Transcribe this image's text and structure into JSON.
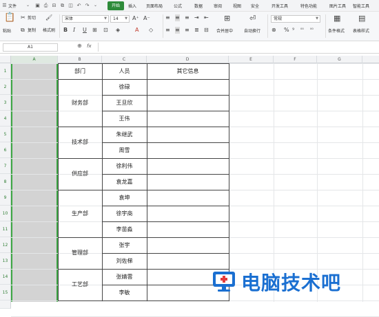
{
  "menubar": {
    "file_label": "文件",
    "tabs": [
      "开始",
      "插入",
      "页面布局",
      "公式",
      "数据",
      "审阅",
      "视图",
      "安全",
      "开发工具",
      "特色功能",
      "图片工具",
      "智能工具"
    ],
    "active_tab": "开始"
  },
  "ribbon": {
    "cut": "剪切",
    "paste": "粘贴",
    "copy": "复制",
    "format_painter": "格式刷",
    "font_name": "宋体",
    "font_size": "14",
    "merge_center": "合并居中",
    "wrap_text": "自动换行",
    "number_format": "常规",
    "conditional_format": "条件格式",
    "table_style": "表格样式"
  },
  "formula_bar": {
    "name_box": "A1",
    "fx": "fx",
    "content": ""
  },
  "sheet": {
    "columns": [
      "A",
      "B",
      "C",
      "D",
      "E",
      "F",
      "G"
    ],
    "selected_column": "A",
    "rows": [
      "1",
      "2",
      "3",
      "4",
      "5",
      "6",
      "7",
      "8",
      "9",
      "10",
      "11",
      "12",
      "13",
      "14",
      "15"
    ],
    "headers": {
      "dept": "部门",
      "person": "人员",
      "other": "其它信息"
    },
    "departments": [
      "财务部",
      "技术部",
      "供应部",
      "生产部",
      "管理部",
      "工艺部"
    ],
    "people": [
      "徐碌",
      "王旦欣",
      "王伟",
      "朱继武",
      "周雪",
      "徐利伟",
      "袁龙嘉",
      "袁坤",
      "徐宇商",
      "李苗淼",
      "张宇",
      "刘佐梯",
      "张婧雲",
      "李敏"
    ]
  },
  "watermark": {
    "text": "电脑技术吧",
    "color": "#1a6fd1"
  }
}
